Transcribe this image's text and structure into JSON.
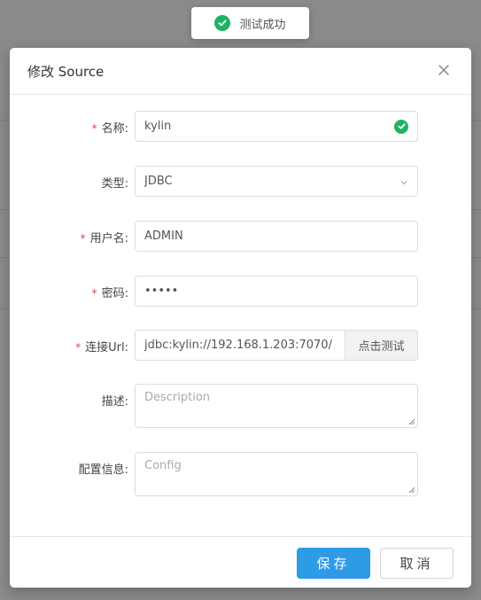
{
  "toast": {
    "message": "测试成功",
    "icon": "check-circle-icon"
  },
  "modal": {
    "title": "修改 Source",
    "close_icon": "close-icon",
    "required_mark": "*",
    "fields": {
      "name": {
        "label": "名称:",
        "value": "kylin",
        "required": true
      },
      "type": {
        "label": "类型:",
        "value": "JDBC",
        "required": false
      },
      "username": {
        "label": "用户名:",
        "value": "ADMIN",
        "required": true
      },
      "password": {
        "label": "密码:",
        "value": "•••••",
        "required": true
      },
      "url": {
        "label": "连接Url:",
        "value": "jdbc:kylin://192.168.1.203:7070/",
        "required": true,
        "test_button": "点击测试"
      },
      "description": {
        "label": "描述:",
        "placeholder": "Description",
        "value": ""
      },
      "config": {
        "label": "配置信息:",
        "placeholder": "Config",
        "value": ""
      }
    },
    "footer": {
      "save_label": "保存",
      "cancel_label": "取消"
    }
  },
  "colors": {
    "primary": "#2d9be6",
    "success": "#1eb366",
    "required": "#e54545",
    "overlay": "#8a8a8a"
  }
}
